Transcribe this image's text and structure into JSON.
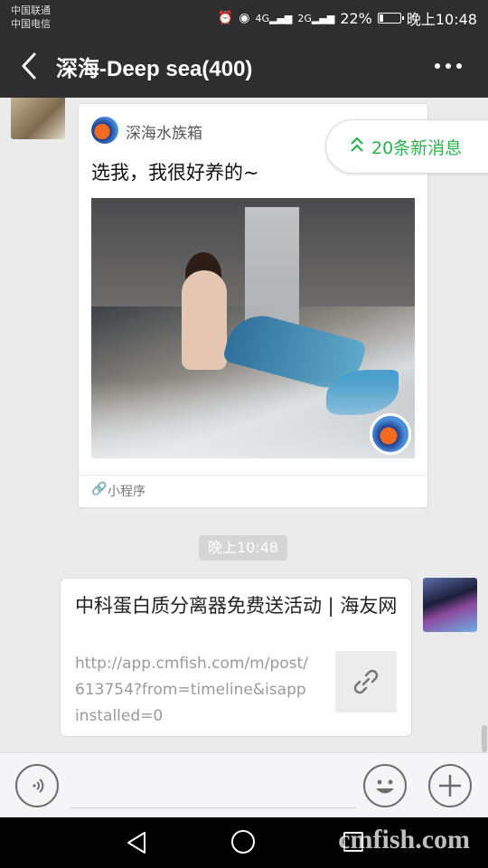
{
  "status_bar": {
    "carrier1": "中国联通",
    "carrier2": "中国电信",
    "icons": [
      "alarm-icon",
      "eye-icon",
      "4g-signal-icon",
      "2g-signal-icon"
    ],
    "net1": "4G",
    "net2": "2G",
    "battery_percent": "22%",
    "battery_level": 0.22,
    "time": "晚上10:48"
  },
  "header": {
    "title": "深海-Deep sea(400)",
    "back_icon": "chevron-left-icon",
    "more_icon": "more-dots-icon"
  },
  "new_messages": {
    "label": "20条新消息",
    "icon": "double-chevron-up-icon",
    "color": "#2bb24c"
  },
  "mini_program_card": {
    "app_name": "深海水族箱",
    "message": "选我，我很好养的~",
    "footer_label": "小程序",
    "footer_icon": "mini-program-icon"
  },
  "timestamp": "晚上10:48",
  "link_card": {
    "title": "中科蛋白质分离器免费送活动 | 海友网",
    "url": "http://app.cmfish.com/m/post/613754?from=timeline&isappinstalled=0",
    "thumb_icon": "link-icon"
  },
  "input_bar": {
    "voice_icon": "voice-icon",
    "text_value": "",
    "emoji_icon": "emoji-icon",
    "plus_icon": "plus-icon"
  },
  "nav_bar": {
    "icons": [
      "back-triangle-icon",
      "home-circle-icon",
      "recent-square-icon"
    ]
  },
  "watermark": "cmfish.com"
}
